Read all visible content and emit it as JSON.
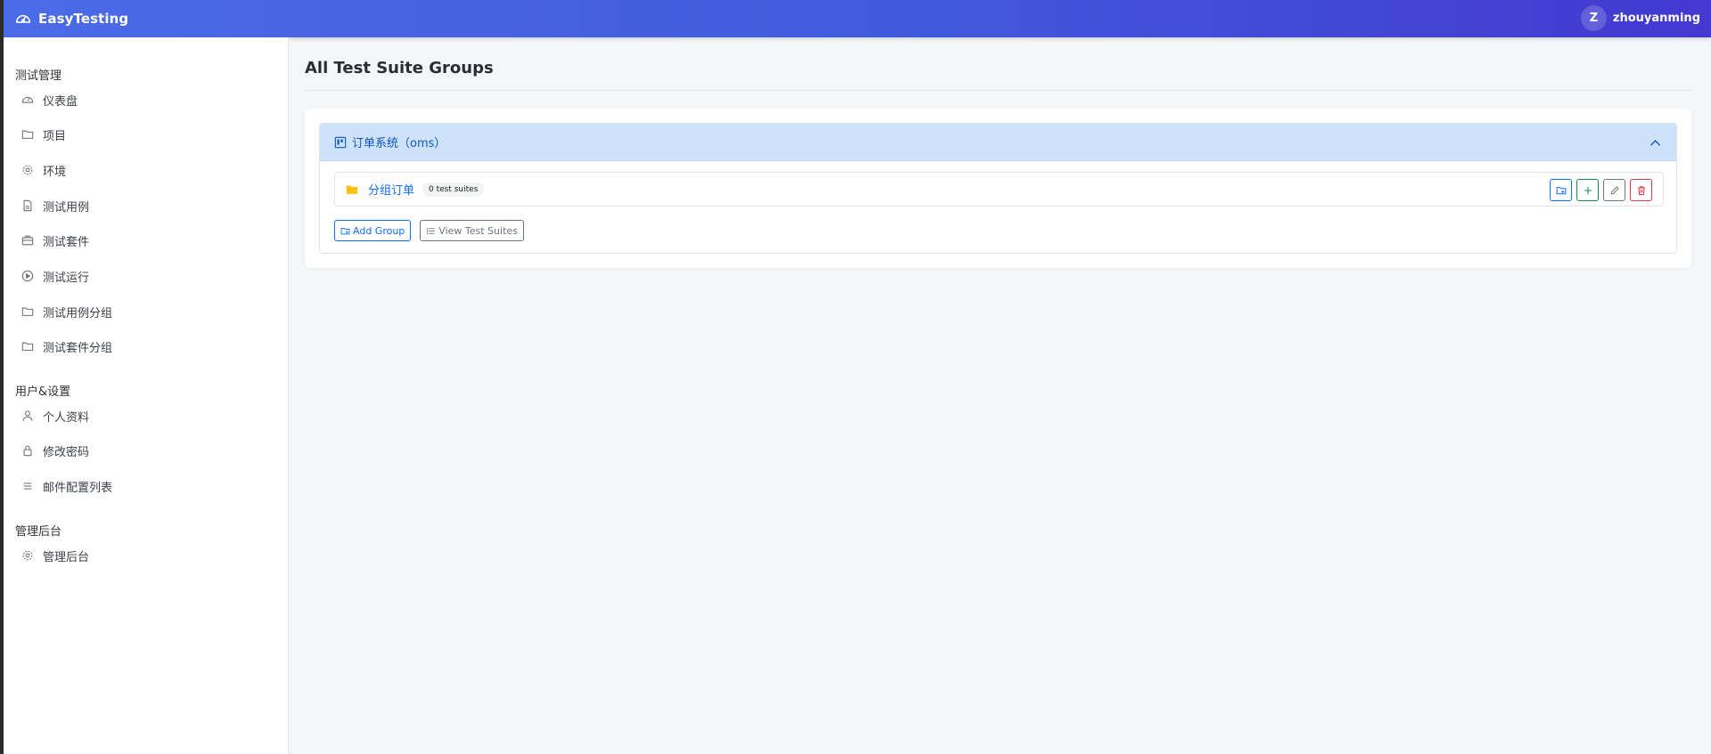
{
  "app": {
    "name": "EasyTesting"
  },
  "user": {
    "initial": "Z",
    "name": "zhouyanming"
  },
  "sidebar": {
    "sections": [
      {
        "title": "测试管理",
        "items": [
          {
            "label": "仪表盘",
            "icon": "dashboard-icon"
          },
          {
            "label": "项目",
            "icon": "folder-icon"
          },
          {
            "label": "环境",
            "icon": "gear-icon"
          },
          {
            "label": "测试用例",
            "icon": "file-icon"
          },
          {
            "label": "测试套件",
            "icon": "briefcase-icon"
          },
          {
            "label": "测试运行",
            "icon": "play-circle-icon"
          },
          {
            "label": "测试用例分组",
            "icon": "folder-icon"
          },
          {
            "label": "测试套件分组",
            "icon": "folder-icon"
          }
        ]
      },
      {
        "title": "用户&设置",
        "items": [
          {
            "label": "个人资料",
            "icon": "person-icon"
          },
          {
            "label": "修改密码",
            "icon": "lock-icon"
          },
          {
            "label": "邮件配置列表",
            "icon": "list-icon"
          }
        ]
      },
      {
        "title": "管理后台",
        "items": [
          {
            "label": "管理后台",
            "icon": "gear-icon"
          }
        ]
      }
    ]
  },
  "main": {
    "title": "All Test Suite Groups",
    "project": {
      "label": "订单系统（oms）",
      "expanded": true,
      "groups": [
        {
          "name": "分组订单",
          "badge": "0 test suites"
        }
      ]
    },
    "actions": {
      "add_group": "Add Group",
      "view_suites": "View Test Suites"
    }
  },
  "colors": {
    "header_gradient_start": "#4a6be8",
    "header_gradient_end": "#4338cf",
    "accordion_header_bg": "#cfe2fc",
    "link_blue": "#0d6efd",
    "folder_yellow": "#ffc107"
  }
}
